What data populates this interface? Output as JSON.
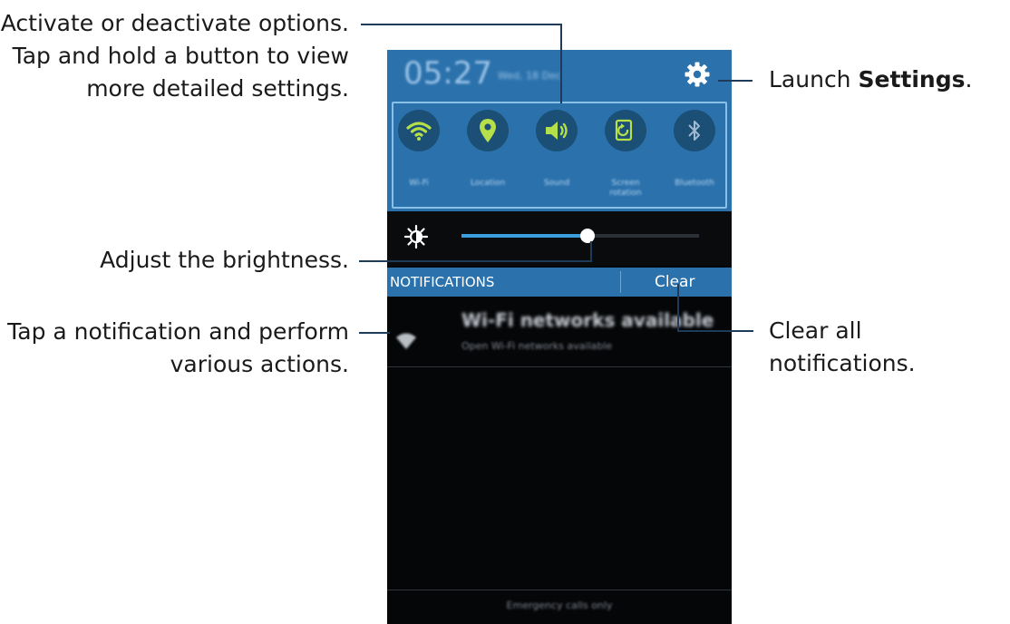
{
  "callouts": {
    "options_line1": "Activate or deactivate options.",
    "options_line2": "Tap and hold a button to view",
    "options_line3": "more detailed settings.",
    "brightness": "Adjust the brightness.",
    "notification_line1": "Tap a notification and perform",
    "notification_line2": "various actions.",
    "settings_prefix": "Launch ",
    "settings_bold": "Settings",
    "settings_suffix": ".",
    "clear": "Clear all notifications."
  },
  "phone": {
    "status_bar": {
      "time": "05:27",
      "date": "Wed, 18 Dec",
      "settings_icon": "gear-icon"
    },
    "quick_settings": [
      {
        "label": "Wi-Fi",
        "icon": "wifi-icon",
        "active": true
      },
      {
        "label": "Location",
        "icon": "location-pin-icon",
        "active": true
      },
      {
        "label": "Sound",
        "icon": "speaker-icon",
        "active": true
      },
      {
        "label": "Screen rotation",
        "icon": "screen-rotation-icon",
        "active": true
      },
      {
        "label": "Bluetooth",
        "icon": "bluetooth-icon",
        "active": false
      }
    ],
    "brightness": {
      "icon": "brightness-sun-icon",
      "level": 0.53
    },
    "notifications_header": {
      "title": "NOTIFICATIONS",
      "clear_label": "Clear"
    },
    "notification": {
      "icon": "wifi-notification-icon",
      "title": "Wi-Fi networks available",
      "subtitle": "Open Wi-Fi networks available"
    },
    "footer": "Emergency calls only"
  },
  "colors": {
    "panel_blue": "#2b72ad",
    "toggle_circle": "#1c4f76",
    "active_icon": "#b6e04a",
    "inactive_icon": "#9fb9cf",
    "slider_fill": "#3a9fdc",
    "leader_line": "#1f3b5a"
  }
}
